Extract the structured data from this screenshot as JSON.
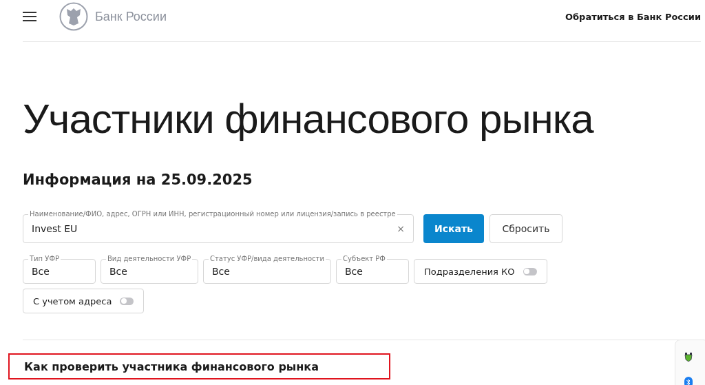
{
  "header": {
    "logo_text": "Банк России",
    "contact_link": "Обратиться в Банк России"
  },
  "title": "Участники финансового рынка",
  "subtitle": "Информация на 25.09.2025",
  "search": {
    "label": "Наименование/ФИО, адрес, ОГРН или ИНН, регистрационный номер или лицензия/запись в реестре",
    "value": "Invest EU",
    "clear": "×"
  },
  "buttons": [
    {
      "label": "Искать",
      "kind": "primary"
    },
    {
      "label": "Сбросить",
      "kind": "secondary"
    }
  ],
  "filters": [
    {
      "label": "Тип УФР",
      "value": "Все"
    },
    {
      "label": "Вид деятельности УФР",
      "value": "Все"
    },
    {
      "label": "Статус УФР/вида деятельности",
      "value": "Все"
    },
    {
      "label": "Субъект РФ",
      "value": "Все"
    }
  ],
  "toggles": [
    {
      "label": "Подразделения КО",
      "on": false
    },
    {
      "label": "С учетом адреса",
      "on": false
    }
  ],
  "section_heading": {
    "text": "Как проверить участника финансового рынка",
    "highlighted": true
  }
}
